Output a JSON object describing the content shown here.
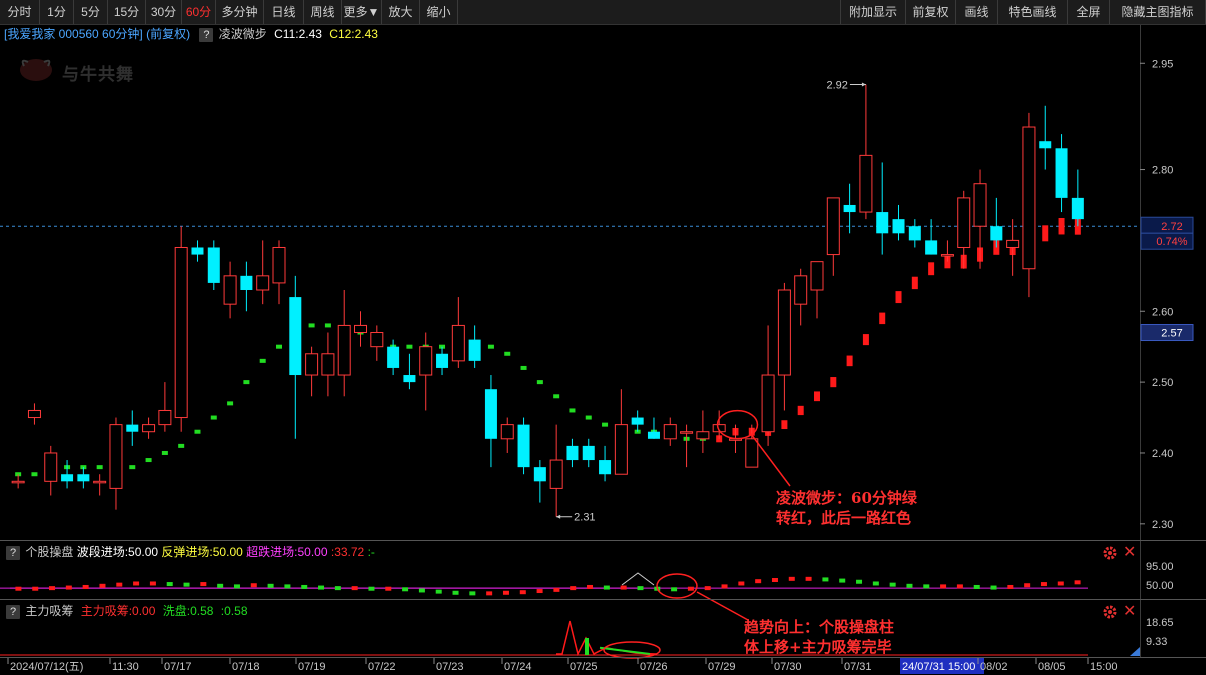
{
  "toolbar": {
    "left": [
      "分时",
      "1分",
      "5分",
      "15分",
      "30分",
      "60分",
      "多分钟",
      "日线",
      "周线",
      "更多▼",
      "放大",
      "缩小"
    ],
    "active_index": 5,
    "right": [
      "附加显示",
      "前复权",
      "画线",
      "特色画线",
      "全屏",
      "隐藏主图指标"
    ]
  },
  "info": {
    "stock": "[我爱我家 000560 60分钟]",
    "adjust": "(前复权)",
    "q": "?",
    "indicator": "凌波微步",
    "c11": "C11:2.43",
    "c12": "C12:2.43"
  },
  "watermark": "与牛共舞",
  "ind1": {
    "q": "?",
    "name": "个股操盘",
    "a_label": "波段进场:50.00",
    "b_label": "反弹进场:50.00",
    "c_label": "超跌进场:50.00",
    "d_label": ":33.72",
    "e_label": ":-",
    "scale_top": "95.00",
    "scale_mid": "50.00"
  },
  "ind2": {
    "q": "?",
    "name": "主力吸筹",
    "a_label": "主力吸筹:0.00",
    "b_label": "洗盘:0.58",
    "c_label": ":0.58",
    "scale_top": "18.65",
    "scale_mid": "9.33"
  },
  "price_axis": {
    "ticks": [
      "2.95",
      "2.80",
      "2.60",
      "2.50",
      "2.40",
      "2.30"
    ],
    "current_price": "2.72",
    "current_pct": "0.74%",
    "crosshair_price": "2.57"
  },
  "time_axis": {
    "labels": [
      "2024/07/12(五)",
      "11:30",
      "07/17",
      "07/18",
      "07/19",
      "07/22",
      "07/23",
      "07/24",
      "07/25",
      "07/26",
      "07/29",
      "07/30",
      "07/31",
      "24/07/31 15:00",
      "08/02",
      "08/05",
      "15:00"
    ]
  },
  "markers": {
    "high": "2.92",
    "low": "2.31"
  },
  "annotations": {
    "a1_line1": "凌波微步：60分钟绿",
    "a1_line2": "转红，此后一路红色",
    "a2_line1": "趋势向上：个股操盘柱",
    "a2_line2": "体上移+主力吸筹完毕"
  },
  "colors": {
    "up": "#ff3a3a",
    "down": "#00f0ff",
    "line_green": "#22dd22",
    "line_red": "#ff1a1a",
    "magenta": "#dd22dd"
  },
  "chart_data": {
    "type": "candlestick",
    "title": "我爱我家 000560 60分钟 (前复权)",
    "ylim": [
      2.28,
      2.98
    ],
    "candles": [
      {
        "o": 2.36,
        "h": 2.37,
        "l": 2.35,
        "c": 2.36
      },
      {
        "o": 2.45,
        "h": 2.47,
        "l": 2.44,
        "c": 2.46
      },
      {
        "o": 2.36,
        "h": 2.41,
        "l": 2.34,
        "c": 2.4
      },
      {
        "o": 2.37,
        "h": 2.39,
        "l": 2.35,
        "c": 2.36
      },
      {
        "o": 2.37,
        "h": 2.38,
        "l": 2.35,
        "c": 2.36
      },
      {
        "o": 2.36,
        "h": 2.37,
        "l": 2.34,
        "c": 2.36
      },
      {
        "o": 2.35,
        "h": 2.45,
        "l": 2.32,
        "c": 2.44
      },
      {
        "o": 2.44,
        "h": 2.46,
        "l": 2.41,
        "c": 2.43
      },
      {
        "o": 2.43,
        "h": 2.45,
        "l": 2.42,
        "c": 2.44
      },
      {
        "o": 2.44,
        "h": 2.5,
        "l": 2.43,
        "c": 2.46
      },
      {
        "o": 2.45,
        "h": 2.72,
        "l": 2.43,
        "c": 2.69
      },
      {
        "o": 2.69,
        "h": 2.7,
        "l": 2.67,
        "c": 2.68
      },
      {
        "o": 2.69,
        "h": 2.7,
        "l": 2.63,
        "c": 2.64
      },
      {
        "o": 2.61,
        "h": 2.67,
        "l": 2.59,
        "c": 2.65
      },
      {
        "o": 2.65,
        "h": 2.67,
        "l": 2.6,
        "c": 2.63
      },
      {
        "o": 2.63,
        "h": 2.7,
        "l": 2.61,
        "c": 2.65
      },
      {
        "o": 2.64,
        "h": 2.7,
        "l": 2.61,
        "c": 2.69
      },
      {
        "o": 2.62,
        "h": 2.65,
        "l": 2.42,
        "c": 2.51
      },
      {
        "o": 2.51,
        "h": 2.55,
        "l": 2.48,
        "c": 2.54
      },
      {
        "o": 2.51,
        "h": 2.57,
        "l": 2.48,
        "c": 2.54
      },
      {
        "o": 2.51,
        "h": 2.63,
        "l": 2.48,
        "c": 2.58
      },
      {
        "o": 2.57,
        "h": 2.6,
        "l": 2.55,
        "c": 2.58
      },
      {
        "o": 2.55,
        "h": 2.58,
        "l": 2.53,
        "c": 2.57
      },
      {
        "o": 2.55,
        "h": 2.56,
        "l": 2.51,
        "c": 2.52
      },
      {
        "o": 2.51,
        "h": 2.54,
        "l": 2.49,
        "c": 2.5
      },
      {
        "o": 2.51,
        "h": 2.57,
        "l": 2.46,
        "c": 2.55
      },
      {
        "o": 2.54,
        "h": 2.55,
        "l": 2.51,
        "c": 2.52
      },
      {
        "o": 2.53,
        "h": 2.62,
        "l": 2.52,
        "c": 2.58
      },
      {
        "o": 2.56,
        "h": 2.58,
        "l": 2.52,
        "c": 2.53
      },
      {
        "o": 2.49,
        "h": 2.51,
        "l": 2.38,
        "c": 2.42
      },
      {
        "o": 2.42,
        "h": 2.45,
        "l": 2.4,
        "c": 2.44
      },
      {
        "o": 2.44,
        "h": 2.45,
        "l": 2.37,
        "c": 2.38
      },
      {
        "o": 2.38,
        "h": 2.39,
        "l": 2.33,
        "c": 2.36
      },
      {
        "o": 2.35,
        "h": 2.44,
        "l": 2.31,
        "c": 2.39
      },
      {
        "o": 2.41,
        "h": 2.42,
        "l": 2.38,
        "c": 2.39
      },
      {
        "o": 2.41,
        "h": 2.42,
        "l": 2.38,
        "c": 2.39
      },
      {
        "o": 2.39,
        "h": 2.41,
        "l": 2.36,
        "c": 2.37
      },
      {
        "o": 2.37,
        "h": 2.49,
        "l": 2.37,
        "c": 2.44
      },
      {
        "o": 2.45,
        "h": 2.46,
        "l": 2.43,
        "c": 2.44
      },
      {
        "o": 2.43,
        "h": 2.45,
        "l": 2.42,
        "c": 2.42
      },
      {
        "o": 2.42,
        "h": 2.45,
        "l": 2.41,
        "c": 2.44
      },
      {
        "o": 2.43,
        "h": 2.44,
        "l": 2.38,
        "c": 2.43
      },
      {
        "o": 2.42,
        "h": 2.46,
        "l": 2.4,
        "c": 2.43
      },
      {
        "o": 2.43,
        "h": 2.46,
        "l": 2.42,
        "c": 2.44
      },
      {
        "o": 2.42,
        "h": 2.44,
        "l": 2.4,
        "c": 2.42
      },
      {
        "o": 2.38,
        "h": 2.44,
        "l": 2.39,
        "c": 2.42
      },
      {
        "o": 2.43,
        "h": 2.58,
        "l": 2.41,
        "c": 2.51
      },
      {
        "o": 2.51,
        "h": 2.64,
        "l": 2.46,
        "c": 2.63
      },
      {
        "o": 2.61,
        "h": 2.66,
        "l": 2.58,
        "c": 2.65
      },
      {
        "o": 2.63,
        "h": 2.67,
        "l": 2.59,
        "c": 2.67
      },
      {
        "o": 2.68,
        "h": 2.76,
        "l": 2.65,
        "c": 2.76
      },
      {
        "o": 2.75,
        "h": 2.78,
        "l": 2.71,
        "c": 2.74
      },
      {
        "o": 2.74,
        "h": 2.92,
        "l": 2.73,
        "c": 2.82
      },
      {
        "o": 2.74,
        "h": 2.81,
        "l": 2.68,
        "c": 2.71
      },
      {
        "o": 2.73,
        "h": 2.75,
        "l": 2.7,
        "c": 2.71
      },
      {
        "o": 2.72,
        "h": 2.73,
        "l": 2.69,
        "c": 2.7
      },
      {
        "o": 2.7,
        "h": 2.73,
        "l": 2.68,
        "c": 2.68
      },
      {
        "o": 2.68,
        "h": 2.7,
        "l": 2.67,
        "c": 2.68
      },
      {
        "o": 2.69,
        "h": 2.77,
        "l": 2.66,
        "c": 2.76
      },
      {
        "o": 2.72,
        "h": 2.8,
        "l": 2.66,
        "c": 2.78
      },
      {
        "o": 2.72,
        "h": 2.76,
        "l": 2.69,
        "c": 2.7
      },
      {
        "o": 2.69,
        "h": 2.73,
        "l": 2.65,
        "c": 2.7
      },
      {
        "o": 2.66,
        "h": 2.88,
        "l": 2.62,
        "c": 2.86
      },
      {
        "o": 2.84,
        "h": 2.89,
        "l": 2.8,
        "c": 2.83
      },
      {
        "o": 2.83,
        "h": 2.85,
        "l": 2.74,
        "c": 2.76
      },
      {
        "o": 2.76,
        "h": 2.8,
        "l": 2.72,
        "c": 2.73
      }
    ],
    "lingbo": [
      2.37,
      2.37,
      2.38,
      2.38,
      2.38,
      2.38,
      2.38,
      2.38,
      2.39,
      2.4,
      2.41,
      2.43,
      2.45,
      2.47,
      2.5,
      2.53,
      2.55,
      2.57,
      2.58,
      2.58,
      2.57,
      2.57,
      2.56,
      2.55,
      2.55,
      2.55,
      2.55,
      2.55,
      2.55,
      2.55,
      2.54,
      2.52,
      2.5,
      2.48,
      2.46,
      2.45,
      2.44,
      2.43,
      2.43,
      2.43,
      2.43,
      2.42,
      2.42,
      2.42,
      2.43,
      2.43,
      2.43,
      2.44,
      2.46,
      2.48,
      2.5,
      2.53,
      2.56,
      2.59,
      2.62,
      2.64,
      2.66,
      2.67,
      2.67,
      2.68,
      2.69,
      2.69,
      2.7,
      2.71,
      2.72,
      2.72
    ],
    "lingbo_red_from": 43,
    "ind1_bars": [
      49,
      49,
      50,
      51,
      52,
      54,
      56,
      58,
      58,
      57,
      56,
      57,
      54,
      53,
      55,
      54,
      53,
      52,
      51,
      50,
      50,
      49,
      49,
      48,
      46,
      44,
      42,
      41,
      41,
      42,
      43,
      45,
      47,
      50,
      52,
      51,
      51,
      50,
      49,
      48,
      49,
      50,
      53,
      58,
      62,
      64,
      66,
      66,
      65,
      63,
      61,
      58,
      56,
      54,
      53,
      53,
      53,
      52,
      51,
      52,
      55,
      57,
      58,
      60
    ],
    "ind2_xipan": [
      0.58,
      0.58,
      18.65,
      0.58,
      9.33,
      0.58,
      4.0,
      2.5,
      1.0,
      0.58
    ],
    "ind2_zhuli": [
      0,
      0,
      0,
      0,
      0,
      0,
      0,
      0,
      0,
      0
    ]
  }
}
